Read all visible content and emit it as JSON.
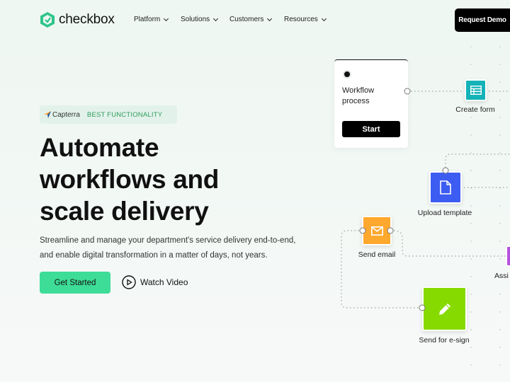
{
  "header": {
    "logo_text": "checkbox",
    "nav": [
      "Platform",
      "Solutions",
      "Customers",
      "Resources"
    ],
    "cta": "Request Demo"
  },
  "badge": {
    "brand": "Capterra",
    "text": "BEST FUNCTIONALITY"
  },
  "hero": {
    "title_lines": [
      "Automate",
      "workflows and",
      "scale delivery"
    ],
    "subtitle": "Streamline and manage your department's service delivery end-to-end, and enable digital transformation in a matter of days, not years.",
    "primary_button": "Get Started",
    "secondary_button": "Watch Video"
  },
  "diagram": {
    "workflow_card": {
      "title": "Workflow process",
      "button": "Start"
    },
    "nodes": [
      {
        "label": "Create form",
        "color": "#14b3b8",
        "icon": "form-icon"
      },
      {
        "label": "Upload template",
        "color": "#3d5cf2",
        "icon": "document-icon"
      },
      {
        "label": "Send email",
        "color": "#ffa82e",
        "icon": "mail-icon"
      },
      {
        "label": "Send for e-sign",
        "color": "#86da00",
        "icon": "pencil-icon"
      },
      {
        "label": "Assi",
        "color": "#b84fe0",
        "icon": "assign-icon"
      }
    ]
  },
  "colors": {
    "brand_green": "#3ddc97",
    "logo_green": "#2fc58a",
    "badge_text": "#2f9b5f"
  }
}
